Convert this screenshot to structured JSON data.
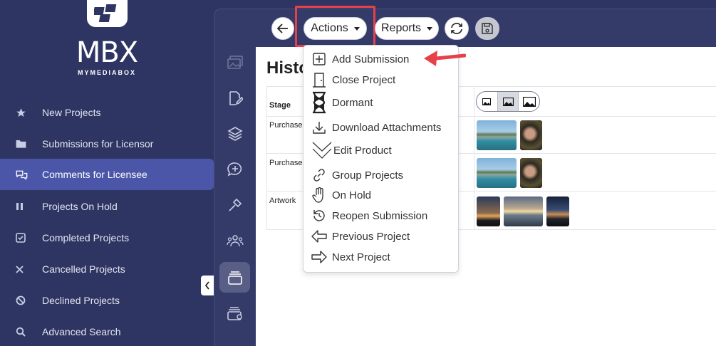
{
  "brand": {
    "name": "MBX",
    "tagline": "MYMEDIABOX"
  },
  "sidebar": {
    "items": [
      {
        "label": "New Projects",
        "icon": "star-icon"
      },
      {
        "label": "Submissions for Licensor",
        "icon": "folder-icon"
      },
      {
        "label": "Comments for Licensee",
        "icon": "comments-icon",
        "active": true
      },
      {
        "label": "Projects On Hold",
        "icon": "pause-icon"
      },
      {
        "label": "Completed Projects",
        "icon": "check-square-icon"
      },
      {
        "label": "Cancelled Projects",
        "icon": "x-icon"
      },
      {
        "label": "Declined Projects",
        "icon": "ban-icon"
      },
      {
        "label": "Advanced Search",
        "icon": "search-icon"
      }
    ]
  },
  "toolbar": {
    "actions_label": "Actions",
    "reports_label": "Reports"
  },
  "page": {
    "title_visible": "Histo"
  },
  "table": {
    "header_stage": "Stage",
    "rows": [
      {
        "stage": "Purchase O"
      },
      {
        "stage": "Purchase O"
      },
      {
        "stage": "Artwork"
      }
    ]
  },
  "actions_menu": {
    "items": [
      {
        "label": "Add Submission",
        "icon": "plus-square-icon"
      },
      {
        "label": "Close Project",
        "icon": "door-icon"
      },
      {
        "label": "Dormant",
        "icon": "hourglass-icon"
      },
      {
        "label": "Download Attachments",
        "icon": "download-icon"
      },
      {
        "label": "Edit Product",
        "icon": "chevrons-down-icon"
      },
      {
        "label": "Group Projects",
        "icon": "link-icon"
      },
      {
        "label": "On Hold",
        "icon": "hand-icon"
      },
      {
        "label": "Reopen Submission",
        "icon": "history-icon"
      },
      {
        "label": "Previous Project",
        "icon": "arrow-left-icon"
      },
      {
        "label": "Next Project",
        "icon": "arrow-right-icon"
      }
    ]
  },
  "colors": {
    "sidebar_bg": "#2f3562",
    "active_item": "#4b56a8",
    "highlight": "#e8404a"
  }
}
